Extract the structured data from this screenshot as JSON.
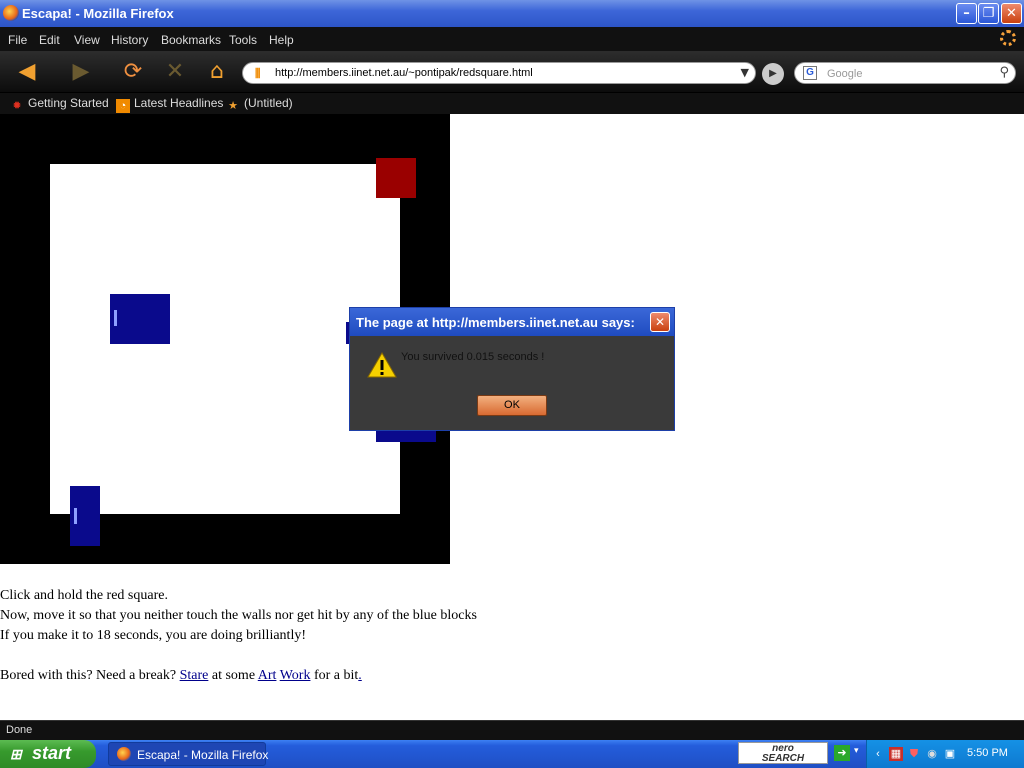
{
  "window": {
    "title": "Escapa! - Mozilla Firefox"
  },
  "menu": [
    {
      "label": "File"
    },
    {
      "label": "Edit"
    },
    {
      "label": "View"
    },
    {
      "label": "History"
    },
    {
      "label": "Bookmarks"
    },
    {
      "label": "Tools"
    },
    {
      "label": "Help"
    }
  ],
  "nav": {
    "url": "http://members.iinet.net.au/~pontipak/redsquare.html",
    "search_placeholder": "Google",
    "search_engine_letter": "G"
  },
  "bookmarks": [
    {
      "label": "Getting Started",
      "icon": "ladybug-icon"
    },
    {
      "label": "Latest Headlines",
      "icon": "rss-icon"
    },
    {
      "label": "(Untitled)",
      "icon": "star-icon"
    }
  ],
  "game": {
    "colors": {
      "wall": "#000000",
      "field": "#ffffff",
      "red": "#9a0000",
      "blue": "#0a0a8c"
    }
  },
  "content": {
    "line1": "Click and hold the red square.",
    "line2": "Now, move it so that you neither touch the walls nor get hit by any of the blue blocks",
    "line3": "If you make it to 18 seconds, you are doing brilliantly!",
    "line4_pre": "Bored with this? Need a break? ",
    "link_stare": "Stare",
    "line4_mid1": " at some ",
    "link_art": "Art",
    "link_work": "Work",
    "line4_mid2": " for a bit",
    "line4_end": "."
  },
  "status": {
    "text": "Done"
  },
  "dialog": {
    "title": "The page at http://members.iinet.net.au says:",
    "message": "You survived 0.015 seconds !",
    "ok_label": "OK",
    "icon": "warning-icon"
  },
  "taskbar": {
    "start_label": "start",
    "task_title": "Escapa! - Mozilla Firefox",
    "nero_label_1": "nero",
    "nero_label_2": "SEARCH",
    "clock": "5:50 PM"
  }
}
